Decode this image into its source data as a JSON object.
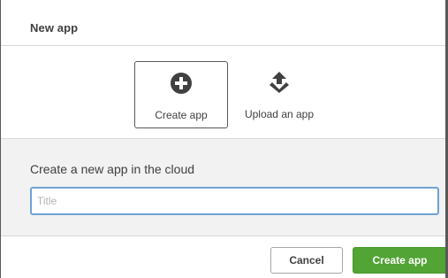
{
  "dialog": {
    "title": "New app"
  },
  "options": [
    {
      "label": "Create app",
      "icon": "plus-circle-icon",
      "selected": true
    },
    {
      "label": "Upload an app",
      "icon": "upload-icon",
      "selected": false
    }
  ],
  "section": {
    "title": "Create a new app in the cloud",
    "input_placeholder": "Title",
    "input_value": ""
  },
  "footer": {
    "cancel_label": "Cancel",
    "create_label": "Create app"
  },
  "colors": {
    "primary_green": "#52a435",
    "focus_blue": "#6fa3d4",
    "text_dark": "#404040",
    "panel_gray": "#f2f2f2"
  }
}
